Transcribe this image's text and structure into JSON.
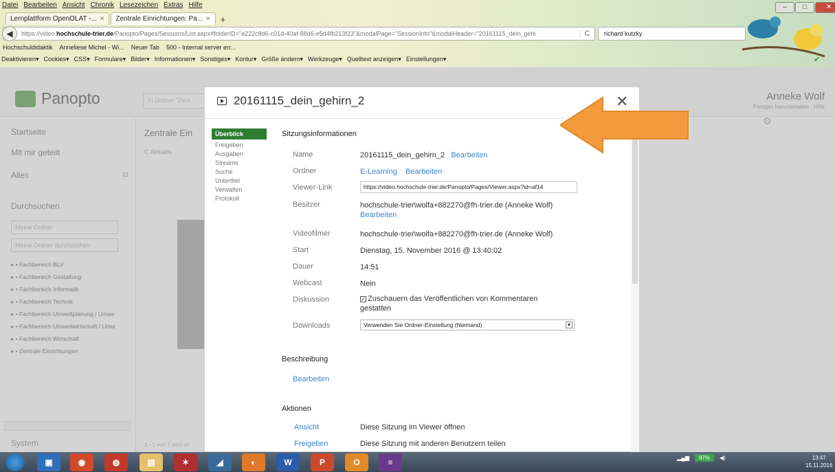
{
  "browser": {
    "menu": [
      "Datei",
      "Bearbeiten",
      "Ansicht",
      "Chronik",
      "Lesezeichen",
      "Extras",
      "Hilfe"
    ],
    "tabs": [
      {
        "label": "Lernplattform OpenOLAT -..."
      },
      {
        "label": "Zentrale Einrichtungen: Pa..."
      }
    ],
    "url_prefix": "https://video.",
    "url_host": "hochschule-trier.de",
    "url_rest": "/Panopto/Pages/Sessions/List.aspx#folderID=\"a222c8d6-c01d-40af-88d6-e5d4fb213f23\"&modalPage=\"SessionInfo\"&modalHeader=\"20161115_dein_gehi",
    "search_value": "richard kutzky",
    "bookmarks": [
      "Hochschuldidaktik",
      "Anneliese Michel - Wi...",
      "Neuer Tab",
      "500 - Internal server err..."
    ],
    "devtools": [
      "Deaktivieren▾",
      "Cookies▾",
      "CSS▾",
      "Formulare▾",
      "Bilder▾",
      "Informationen▾",
      "Sonstiges▾",
      "Kontur▾",
      "Größe ändern▾",
      "Werkzeuge▾",
      "Quelltext anzeigen▾",
      "Einstellungen▾"
    ]
  },
  "panopto": {
    "logo": "Panopto",
    "search_placeholder": "In Ordner \"Zent",
    "user_name": "Anneke Wolf",
    "user_sub": "Panopto herunterladen · Hilfe",
    "nav": {
      "home": "Startseite",
      "shared": "Mit mir geteilt",
      "all": "Alles",
      "all_count": "21",
      "browse": "Durchsuchen",
      "my_folder": "Meine Ordner",
      "search_folder": "Meine Ordner durchsuchen",
      "folders": [
        "Fachbereich BLV",
        "Fachbereich Gestaltung",
        "Fachbereich Informatik",
        "Fachbereich Technik",
        "Fachbereich Umweltplanung / Umwe",
        "Fachbereich Umweltwirtschaft / Umw",
        "Fachbereich Wirtschaft",
        "Zentrale Einrichtungen"
      ],
      "system": "System"
    },
    "main_heading": "Zentrale Ein",
    "main_tools": "C Aktualis",
    "pager": "1 - 1 von 1 wird an"
  },
  "modal": {
    "title": "20161115_dein_gehirn_2",
    "nav": [
      "Überblick",
      "Freigeben",
      "Ausgaben",
      "Streams",
      "Suche",
      "Untertitel",
      "Verwalten",
      "Protokoll"
    ],
    "section_info": "Sitzungsinformationen",
    "labels": {
      "name": "Name",
      "folder": "Ordner",
      "viewer": "Viewer-Link",
      "owner": "Besitzer",
      "videographer": "Videofilmer",
      "start": "Start",
      "duration": "Dauer",
      "webcast": "Webcast",
      "discussion": "Diskussion",
      "downloads": "Downloads"
    },
    "values": {
      "name": "20161115_dein_gehirn_2",
      "edit": "Bearbeiten",
      "folder": "E-Learning",
      "viewer": "https://video.hochschule-trier.de/Panopto/Pages/Viewer.aspx?id=af14",
      "owner": "hochschule-trier\\wolfa+882270@fh-trier.de (Anneke Wolf)",
      "videographer": "hochschule-trier\\wolfa+882270@fh-trier.de (Anneke Wolf)",
      "start": "Dienstag, 15. November 2016 @ 13:40:02",
      "duration": "14:51",
      "webcast": "Nein",
      "discussion": "Zuschauern das Veröffentlichen von Kommentaren gestatten",
      "downloads": "Verwenden Sie Ordner-Einstellung (Niemand)"
    },
    "section_desc": "Beschreibung",
    "section_actions": "Aktionen",
    "actions": [
      {
        "label": "Ansicht",
        "desc": "Diese Sitzung im Viewer öffnen"
      },
      {
        "label": "Freigeben",
        "desc": "Diese Sitzung mit anderen Benutzern teilen"
      }
    ]
  },
  "taskbar": {
    "battery": "97%",
    "time": "13:47",
    "date": "15.11.2016"
  },
  "colors": {
    "arrow": "#f29a3c",
    "accent_green": "#2e7d32",
    "link": "#3a87c9"
  }
}
